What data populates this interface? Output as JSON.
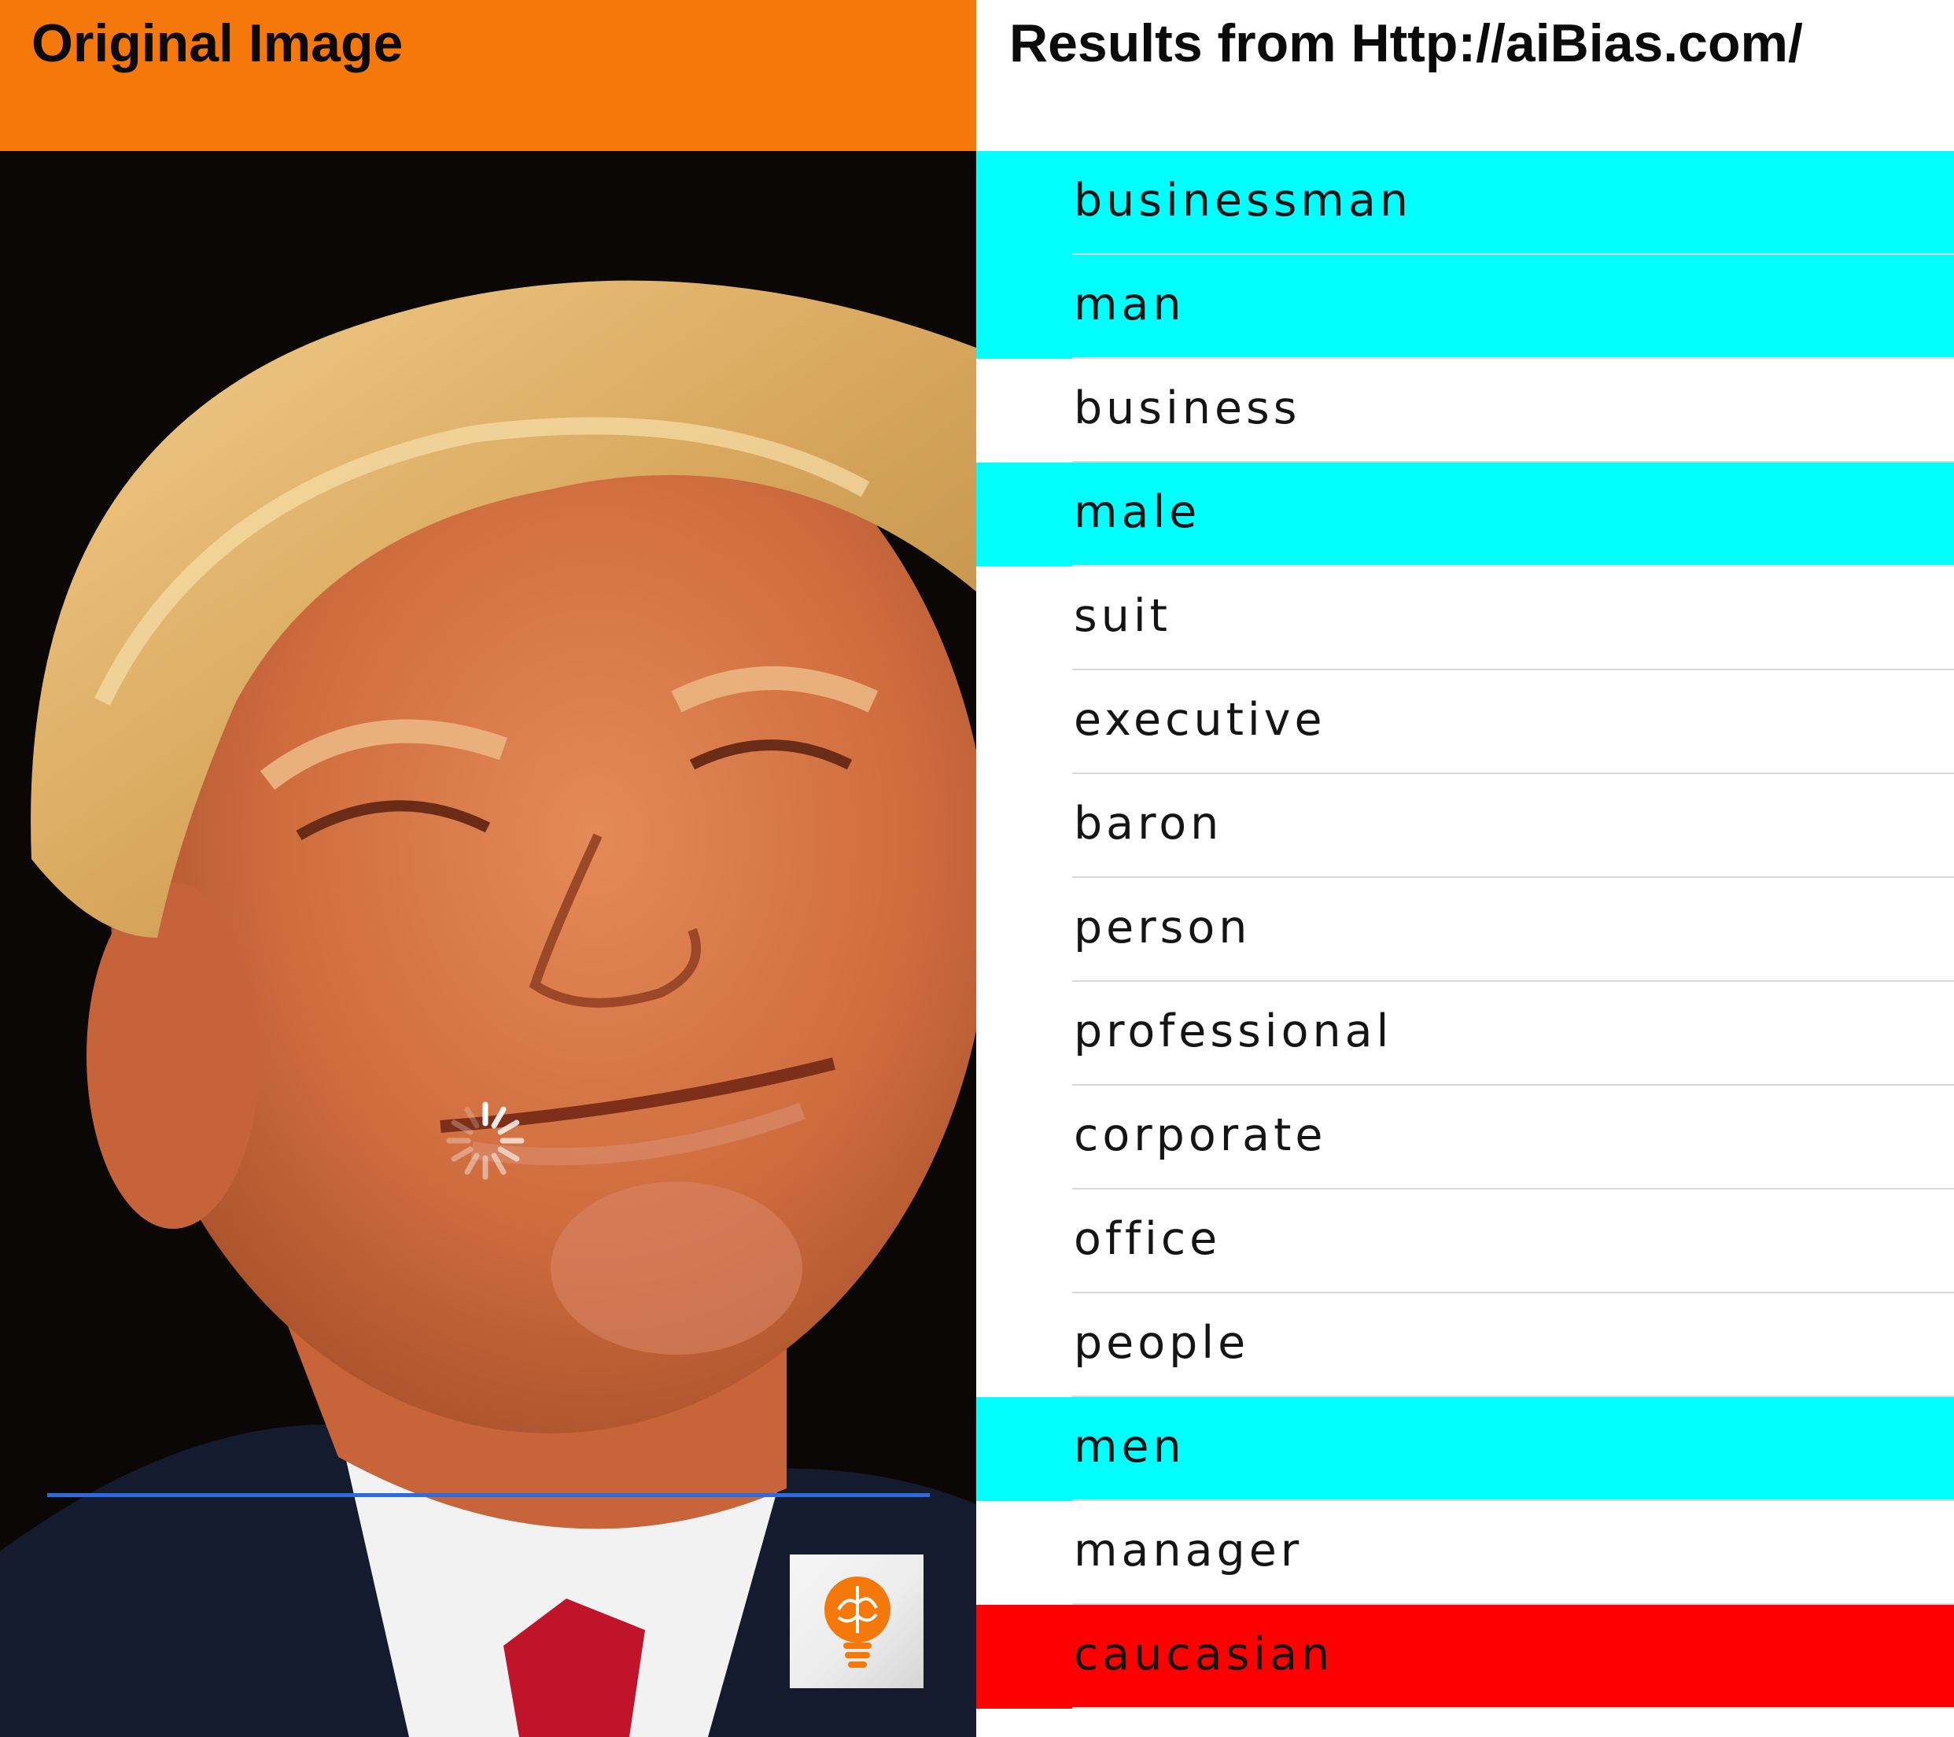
{
  "left_panel": {
    "title": "Original Image",
    "header_color": "#f5790a",
    "photo": {
      "subject": "smiling-face-photo"
    },
    "loading_indicator": "spinner-icon",
    "badge_icon": "lightbulb-brain-icon"
  },
  "right_panel": {
    "title": "Results from Http://aiBias.com/",
    "highlight_colors": {
      "cyan": "#00ffff",
      "red": "#ff0000"
    },
    "tags": [
      {
        "label": "businessman",
        "highlight": "cyan"
      },
      {
        "label": "man",
        "highlight": "cyan"
      },
      {
        "label": "business",
        "highlight": "none"
      },
      {
        "label": "male",
        "highlight": "cyan"
      },
      {
        "label": "suit",
        "highlight": "none"
      },
      {
        "label": "executive",
        "highlight": "none"
      },
      {
        "label": "baron",
        "highlight": "none"
      },
      {
        "label": "person",
        "highlight": "none"
      },
      {
        "label": "professional",
        "highlight": "none"
      },
      {
        "label": "corporate",
        "highlight": "none"
      },
      {
        "label": "office",
        "highlight": "none"
      },
      {
        "label": "people",
        "highlight": "none"
      },
      {
        "label": "men",
        "highlight": "cyan"
      },
      {
        "label": "manager",
        "highlight": "none"
      },
      {
        "label": "caucasian",
        "highlight": "red"
      }
    ]
  }
}
